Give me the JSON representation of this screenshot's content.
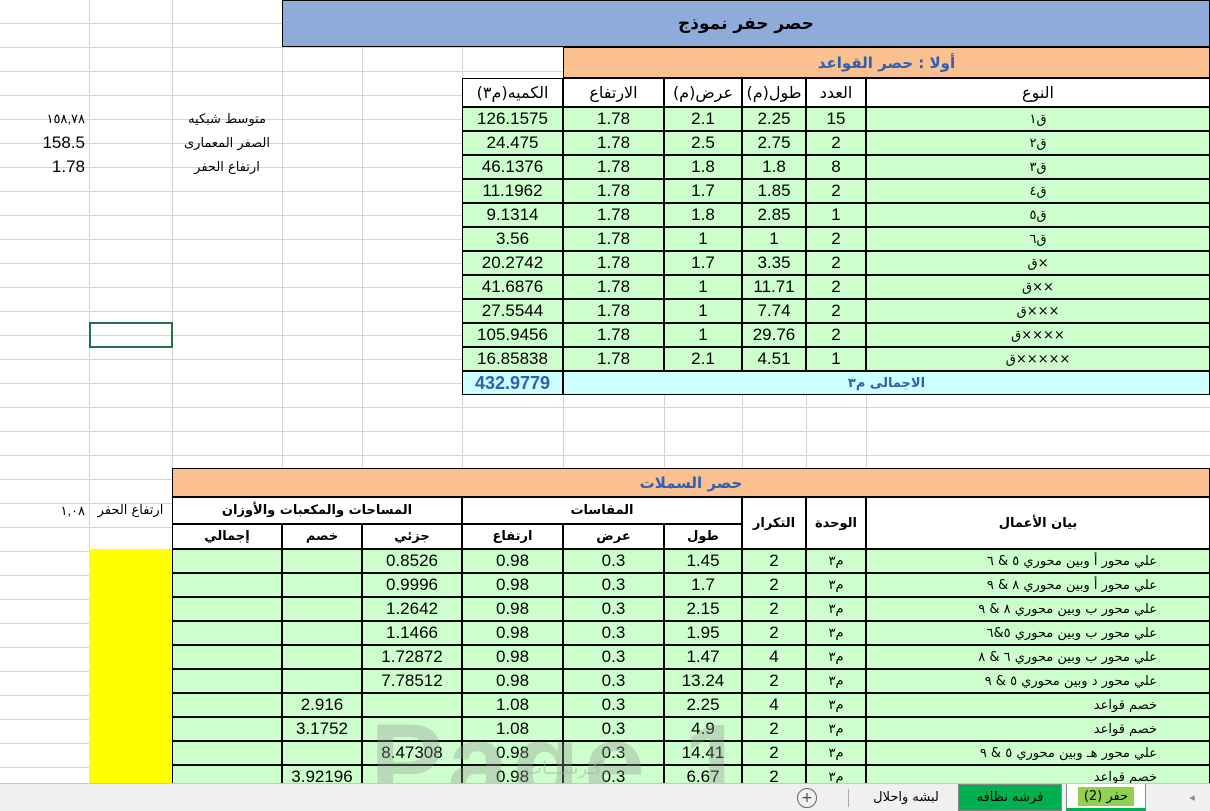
{
  "sheet": {
    "title": "حصر حفر نموذج",
    "side_labels": {
      "avg_grid_value": "١٥٨,٧٨",
      "avg_grid_label": "متوسط شبكيه",
      "arch_zero_value": "158.5",
      "arch_zero_label": "الصفر المعمارى",
      "dig_height_value": "1.78",
      "dig_height_label": "ارتفاع الحفر",
      "dig_height2_value": "١,٠٨",
      "dig_height2_label": "ارتفاع الحفر"
    }
  },
  "footings": {
    "section_title": "أولا : حصر القواعد",
    "headers": {
      "type": "النوع",
      "count": "العدد",
      "length": "طول(م)",
      "width": "عرض(م)",
      "height": "الارتفاع",
      "qty": "الكميه(م٣)"
    },
    "rows": [
      {
        "type": "ق١",
        "count": "15",
        "length": "2.25",
        "width": "2.1",
        "height": "1.78",
        "qty": "126.1575"
      },
      {
        "type": "ق٢",
        "count": "2",
        "length": "2.75",
        "width": "2.5",
        "height": "1.78",
        "qty": "24.475"
      },
      {
        "type": "ق٣",
        "count": "8",
        "length": "1.8",
        "width": "1.8",
        "height": "1.78",
        "qty": "46.1376"
      },
      {
        "type": "ق٤",
        "count": "2",
        "length": "1.85",
        "width": "1.7",
        "height": "1.78",
        "qty": "11.1962"
      },
      {
        "type": "ق٥",
        "count": "1",
        "length": "2.85",
        "width": "1.8",
        "height": "1.78",
        "qty": "9.1314"
      },
      {
        "type": "ق٦",
        "count": "2",
        "length": "1",
        "width": "1",
        "height": "1.78",
        "qty": "3.56"
      },
      {
        "type": "ق×",
        "count": "2",
        "length": "3.35",
        "width": "1.7",
        "height": "1.78",
        "qty": "20.2742"
      },
      {
        "type": "ق××",
        "count": "2",
        "length": "11.71",
        "width": "1",
        "height": "1.78",
        "qty": "41.6876"
      },
      {
        "type": "ق×××",
        "count": "2",
        "length": "7.74",
        "width": "1",
        "height": "1.78",
        "qty": "27.5544"
      },
      {
        "type": "ق××××",
        "count": "2",
        "length": "29.76",
        "width": "1",
        "height": "1.78",
        "qty": "105.9456"
      },
      {
        "type": "ق×××××",
        "count": "1",
        "length": "4.51",
        "width": "2.1",
        "height": "1.78",
        "qty": "16.85838"
      }
    ],
    "total_label": "الاجمالى م٣",
    "total_value": "432.9779"
  },
  "beams": {
    "section_title": "حصر السملات",
    "headers": {
      "desc": "بيان الأعمال",
      "unit": "الوحدة",
      "repeat": "التكرار",
      "dims": "المقاسات",
      "length": "طول",
      "width": "عرض",
      "height": "ارتفاع",
      "areas": "المساحات والمكعبات والأوزان",
      "partial": "جزئي",
      "deduct": "خصم",
      "total": "إجمالي"
    },
    "rows": [
      {
        "desc": "علي محور أ وبين محوري ٥ & ٦",
        "unit": "م٣",
        "repeat": "2",
        "length": "1.45",
        "width": "0.3",
        "height": "0.98",
        "partial": "0.8526",
        "deduct": "",
        "total": ""
      },
      {
        "desc": "علي محور أ وبين محوري ٨ & ٩",
        "unit": "م٣",
        "repeat": "2",
        "length": "1.7",
        "width": "0.3",
        "height": "0.98",
        "partial": "0.9996",
        "deduct": "",
        "total": ""
      },
      {
        "desc": "علي محور ب وبين محوري ٨ & ٩",
        "unit": "م٣",
        "repeat": "2",
        "length": "2.15",
        "width": "0.3",
        "height": "0.98",
        "partial": "1.2642",
        "deduct": "",
        "total": ""
      },
      {
        "desc": "علي محور ب وبين محوري ٥&٦",
        "unit": "م٣",
        "repeat": "2",
        "length": "1.95",
        "width": "0.3",
        "height": "0.98",
        "partial": "1.1466",
        "deduct": "",
        "total": ""
      },
      {
        "desc": "علي محور ب وبين محوري ٦ & ٨",
        "unit": "م٣",
        "repeat": "4",
        "length": "1.47",
        "width": "0.3",
        "height": "0.98",
        "partial": "1.72872",
        "deduct": "",
        "total": ""
      },
      {
        "desc": "علي محور د وبين محوري ٥ & ٩",
        "unit": "م٣",
        "repeat": "2",
        "length": "13.24",
        "width": "0.3",
        "height": "0.98",
        "partial": "7.78512",
        "deduct": "",
        "total": ""
      },
      {
        "desc": "خصم قواعد",
        "unit": "م٣",
        "repeat": "4",
        "length": "2.25",
        "width": "0.3",
        "height": "1.08",
        "partial": "",
        "deduct": "2.916",
        "total": ""
      },
      {
        "desc": "خصم قواعد",
        "unit": "م٣",
        "repeat": "2",
        "length": "4.9",
        "width": "0.3",
        "height": "1.08",
        "partial": "",
        "deduct": "3.1752",
        "total": ""
      },
      {
        "desc": "علي محور هـ وبين محوري ٥ & ٩",
        "unit": "م٣",
        "repeat": "2",
        "length": "14.41",
        "width": "0.3",
        "height": "0.98",
        "partial": "8.47308",
        "deduct": "",
        "total": ""
      },
      {
        "desc": "خصم قواعد",
        "unit": "م٣",
        "repeat": "2",
        "length": "6.67",
        "width": "0.3",
        "height": "0.98",
        "partial": "",
        "deduct": "3.92196",
        "total": ""
      }
    ]
  },
  "watermark": {
    "text": "Page 1",
    "site": "كـرســـات"
  },
  "tabs": {
    "items": [
      {
        "label": "حفر (2)",
        "active": true
      },
      {
        "label": "فرشه نظافه",
        "active": false
      },
      {
        "label": "لبشه واحلال",
        "active": false
      }
    ],
    "add_label": "+",
    "scroll_label": "◂"
  }
}
